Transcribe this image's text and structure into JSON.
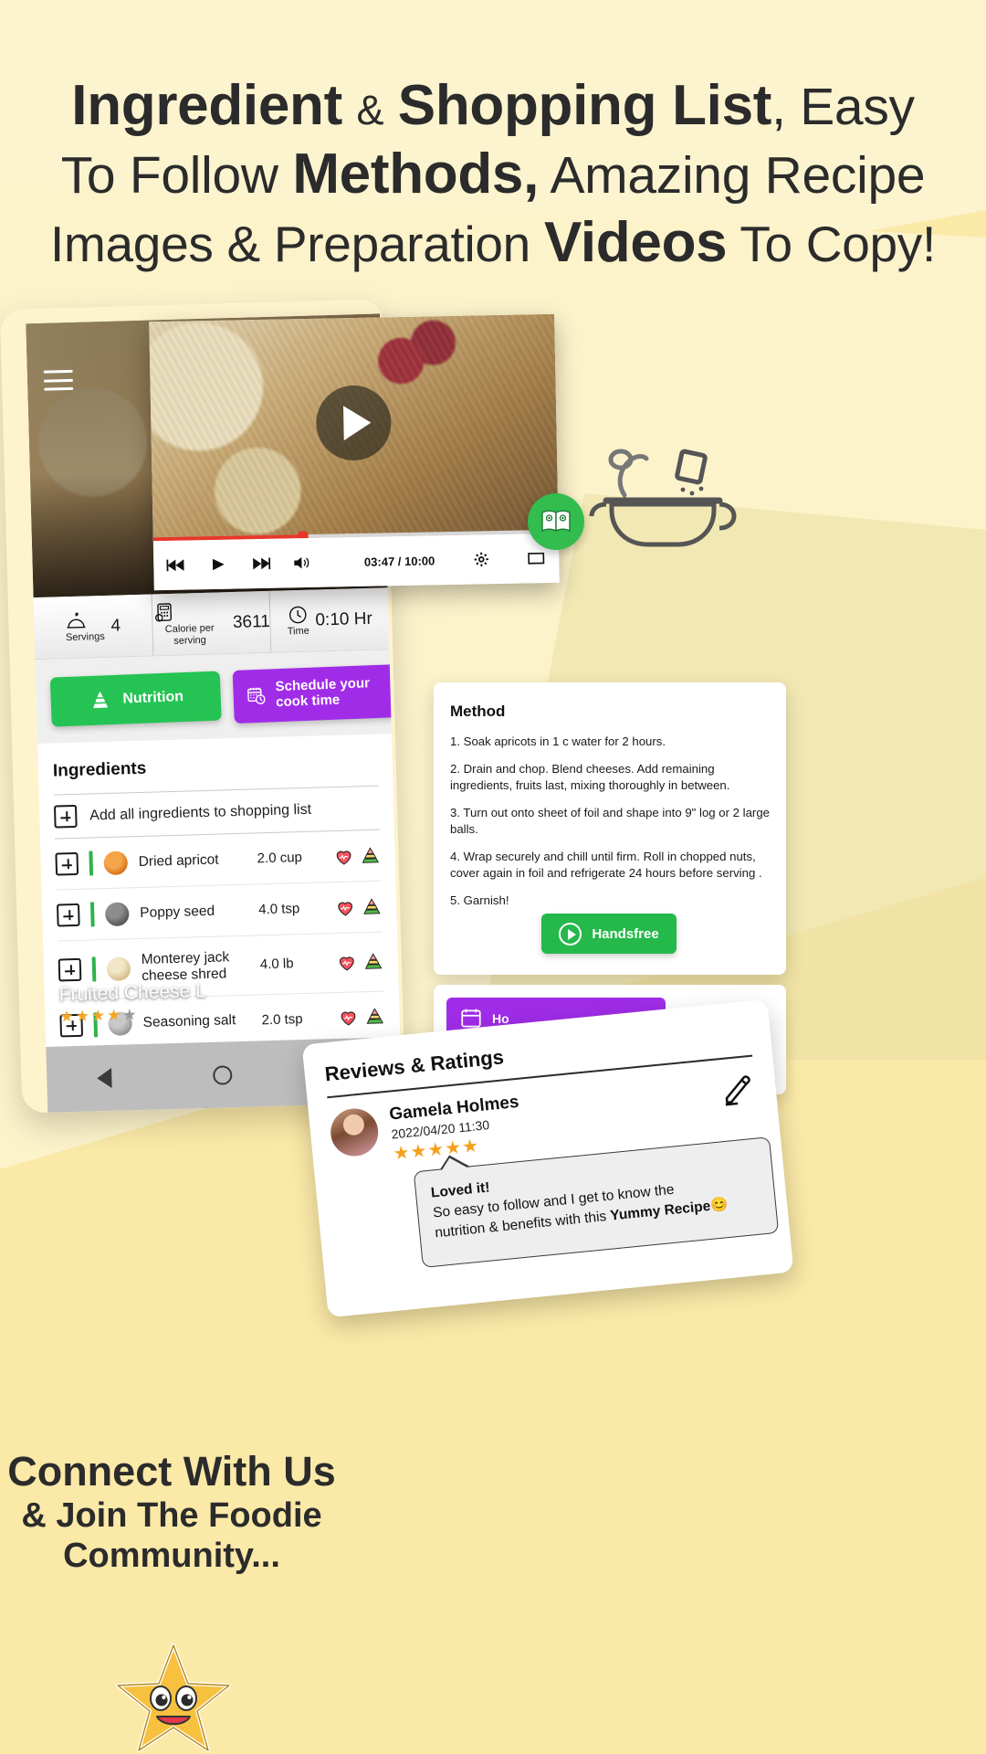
{
  "headline": {
    "line1_a": "Ingredient",
    "line1_b": "&",
    "line1_c": "Shopping List",
    "line1_d": ", Easy",
    "line2_a": "To Follow",
    "line2_b": "Methods,",
    "line2_c": "Amazing Recipe",
    "line3_a": "Images & Preparation",
    "line3_b": "Videos",
    "line3_c": "To Copy!"
  },
  "colors": {
    "background": "#fbe9a8",
    "cream": "#fcf4cf",
    "green": "#25c353",
    "purple": "#a02ce8",
    "red_progress": "#e8362a",
    "star_gold": "#f5a01c"
  },
  "tablet": {
    "hero": {
      "recipe_title": "Fruited Cheese L",
      "stars_filled": 4,
      "stars_total": 5,
      "menu_icon": "hamburger-menu-icon"
    },
    "stats": [
      {
        "icon": "serving-dome-icon",
        "label": "Servings",
        "value": "4"
      },
      {
        "icon": "calorie-calculator-icon",
        "label": "Calorie per serving",
        "value": "3611"
      },
      {
        "icon": "clock-icon",
        "label": "Time",
        "value": "0:10 Hr"
      }
    ],
    "actions": {
      "nutrition_label": "Nutrition",
      "nutrition_icon": "pyramid-icon",
      "schedule_label": "Schedule your cook time",
      "schedule_icon": "calendar-clock-icon"
    },
    "ingredients": {
      "heading": "Ingredients",
      "add_all_label": "Add all ingredients to shopping list",
      "rows": [
        {
          "name": "Dried apricot",
          "qty": "2.0 cup",
          "thumb_color": "#e8892b"
        },
        {
          "name": "Poppy seed",
          "qty": "4.0 tsp",
          "thumb_color": "#6b6b6b"
        },
        {
          "name": "Monterey jack cheese shred",
          "qty": "4.0 lb",
          "thumb_color": "#d9c9a8"
        },
        {
          "name": "Seasoning salt",
          "qty": "2.0 tsp",
          "thumb_color": "#9a9a9a"
        }
      ]
    },
    "navbar": [
      "back-triangle-icon",
      "home-circle-icon",
      "recents-square-icon"
    ]
  },
  "video": {
    "play_icon": "play-button-icon",
    "controls": [
      "previous-track-icon",
      "play-icon",
      "next-track-icon",
      "volume-icon"
    ],
    "time": "03:47 / 10:00",
    "settings_icon": "gear-icon",
    "fullscreen_icon": "fullscreen-icon",
    "progress_percent": 37
  },
  "badges": {
    "book_icon": "recipe-book-icon",
    "pot_icon": "cooking-pot-icon"
  },
  "method": {
    "heading": "Method",
    "steps": [
      "1. Soak apricots in 1 c water for 2 hours.",
      "2. Drain and chop. Blend cheeses. Add remaining ingredients, fruits last, mixing thoroughly in between.",
      "3. Turn out onto sheet of foil and shape into 9\" log or 2 large balls.",
      "4. Wrap securely and chill until firm. Roll in chopped nuts, cover again in foil and refrigerate 24 hours before serving .",
      "5. Garnish!"
    ],
    "handsfree_label": "Handsfree",
    "handsfree_icon": "play-circle-icon"
  },
  "purple_card": {
    "label": "Ho",
    "icon": "calendar-icon"
  },
  "reviews": {
    "heading": "Reviews & Ratings",
    "reviewer_name": "Gamela Holmes",
    "date": "2022/04/20 11:30",
    "stars": 5,
    "edit_icon": "pencil-icon",
    "comment_title": "Loved it!",
    "comment_line1": "So easy to follow and I get to know the",
    "comment_line2": "nutrition & benefits with this",
    "comment_bold": "Yummy Recipe",
    "comment_emoji": "😊"
  },
  "footer": {
    "line1": "Connect With Us",
    "line2": "& Join The Foodie",
    "line3": "Community...",
    "mascot_icon": "smiling-star-icon"
  }
}
